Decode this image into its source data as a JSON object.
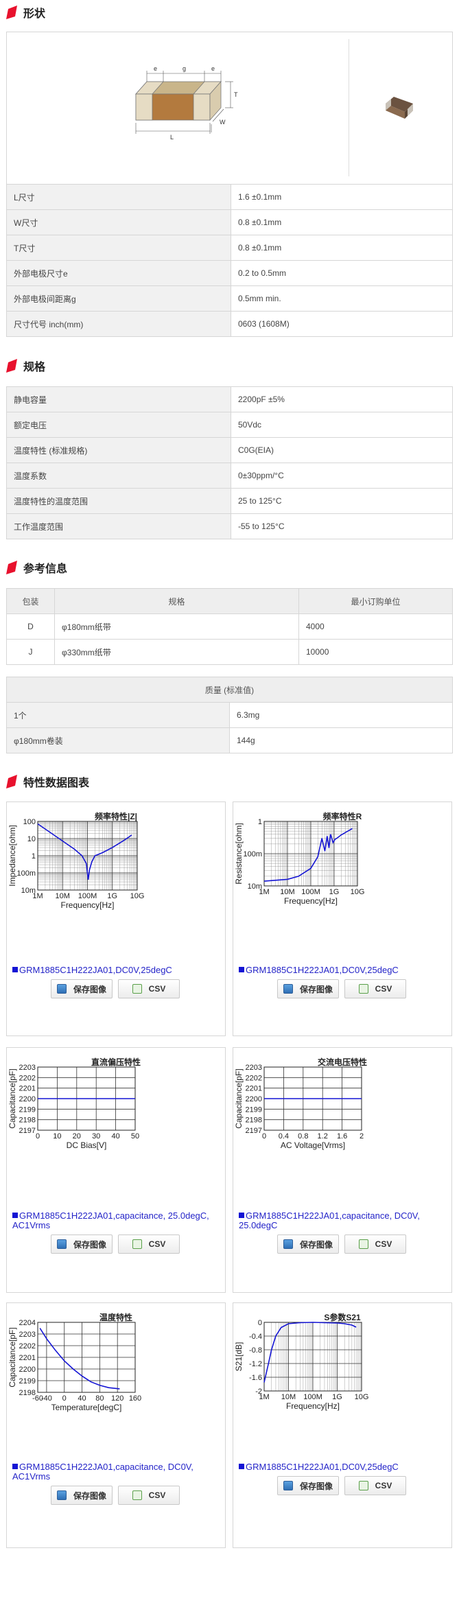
{
  "sections": {
    "shape": "形状",
    "spec": "规格",
    "ref": "参考信息",
    "charts": "特性数据图表"
  },
  "dims": [
    "e",
    "g",
    "e",
    "T",
    "W",
    "L"
  ],
  "shape_rows": [
    {
      "k": "L尺寸",
      "v": "1.6 ±0.1mm"
    },
    {
      "k": "W尺寸",
      "v": "0.8 ±0.1mm"
    },
    {
      "k": "T尺寸",
      "v": "0.8 ±0.1mm"
    },
    {
      "k": "外部电极尺寸e",
      "v": "0.2 to 0.5mm"
    },
    {
      "k": "外部电极间距离g",
      "v": "0.5mm min."
    },
    {
      "k": "尺寸代号 inch(mm)",
      "v": "0603 (1608M)"
    }
  ],
  "spec_rows": [
    {
      "k": "静电容量",
      "v": "2200pF ±5%"
    },
    {
      "k": "额定电压",
      "v": "50Vdc"
    },
    {
      "k": "温度特性 (标准规格)",
      "v": "C0G(EIA)"
    },
    {
      "k": "温度系数",
      "v": "0±30ppm/°C"
    },
    {
      "k": "温度特性的温度范围",
      "v": "25 to 125°C"
    },
    {
      "k": "工作温度范围",
      "v": "-55 to 125°C"
    }
  ],
  "pack": {
    "headers": [
      "包装",
      "规格",
      "最小订购单位"
    ],
    "rows": [
      [
        "D",
        "φ180mm纸带",
        "4000"
      ],
      [
        "J",
        "φ330mm纸带",
        "10000"
      ]
    ]
  },
  "mass": {
    "header": "质量 (标准值)",
    "rows": [
      {
        "k": "1个",
        "v": "6.3mg"
      },
      {
        "k": "φ180mm卷装",
        "v": "144g"
      }
    ]
  },
  "buttons": {
    "save": "保存图像",
    "csv": "CSV"
  },
  "chart_data": [
    {
      "type": "line",
      "title": "频率特性|Z|",
      "xlabel": "Frequency[Hz]",
      "ylabel": "Impedance[ohm]",
      "xscale": "log",
      "yscale": "log",
      "x_ticks": [
        "1M",
        "10M",
        "100M",
        "1G",
        "10G"
      ],
      "y_ticks": [
        "100",
        "10",
        "1",
        "100m",
        "10m"
      ],
      "xlim": [
        1000000,
        10000000000
      ],
      "ylim": [
        0.01,
        100
      ],
      "x": [
        1000000,
        3000000,
        10000000,
        30000000,
        60000000,
        90000000,
        107000000,
        120000000,
        150000000,
        200000000,
        400000000,
        1000000000,
        3000000000,
        6000000000
      ],
      "y": [
        72,
        24,
        7.2,
        2.4,
        1.0,
        0.35,
        0.04,
        0.15,
        0.45,
        1.0,
        1.5,
        3.0,
        8.0,
        16.0
      ],
      "legend": "GRM1885C1H222JA01,DC0V,25degC"
    },
    {
      "type": "line",
      "title": "频率特性R",
      "xlabel": "Frequency[Hz]",
      "ylabel": "Resistance[ohm]",
      "xscale": "log",
      "yscale": "log",
      "x_ticks": [
        "1M",
        "10M",
        "100M",
        "1G",
        "10G"
      ],
      "y_ticks": [
        "1",
        "100m",
        "10m"
      ],
      "xlim": [
        1000000,
        10000000000
      ],
      "ylim": [
        0.01,
        1
      ],
      "x": [
        1000000,
        10000000,
        30000000,
        100000000,
        200000000,
        300000000,
        400000000,
        500000000,
        600000000,
        700000000,
        900000000,
        1100000000,
        1300000000,
        2000000000,
        6000000000
      ],
      "y": [
        0.014,
        0.016,
        0.02,
        0.035,
        0.08,
        0.3,
        0.12,
        0.35,
        0.15,
        0.4,
        0.22,
        0.28,
        0.3,
        0.38,
        0.6
      ],
      "legend": "GRM1885C1H222JA01,DC0V,25degC"
    },
    {
      "type": "line",
      "title": "直流偏压特性",
      "xlabel": "DC Bias[V]",
      "ylabel": "Capacitance[pF]",
      "x_ticks": [
        "0",
        "10",
        "20",
        "30",
        "40",
        "50"
      ],
      "y_ticks": [
        "2203",
        "2202",
        "2201",
        "2200",
        "2199",
        "2198",
        "2197"
      ],
      "xlim": [
        0,
        50
      ],
      "ylim": [
        2197,
        2203
      ],
      "x": [
        0,
        50
      ],
      "y": [
        2200,
        2200
      ],
      "legend": "GRM1885C1H222JA01,capacitance, 25.0degC, AC1Vrms"
    },
    {
      "type": "line",
      "title": "交流电压特性",
      "xlabel": "AC Voltage[Vrms]",
      "ylabel": "Capacitance[pF]",
      "x_ticks": [
        "0",
        "0.4",
        "0.8",
        "1.2",
        "1.6",
        "2"
      ],
      "y_ticks": [
        "2203",
        "2202",
        "2201",
        "2200",
        "2199",
        "2198",
        "2197"
      ],
      "xlim": [
        0,
        2
      ],
      "ylim": [
        2197,
        2203
      ],
      "x": [
        0,
        2
      ],
      "y": [
        2200,
        2200
      ],
      "legend": "GRM1885C1H222JA01,capacitance, DC0V, 25.0degC"
    },
    {
      "type": "line",
      "title": "温度特性",
      "xlabel": "Temperature[degC]",
      "ylabel": "Capacitance[pF]",
      "x_ticks": [
        "-60",
        "-40",
        "0",
        "40",
        "80",
        "120",
        "160"
      ],
      "y_ticks": [
        "2204",
        "2203",
        "2202",
        "2201",
        "2200",
        "2199",
        "2198"
      ],
      "xlim": [
        -60,
        160
      ],
      "ylim": [
        2198,
        2204
      ],
      "x": [
        -55,
        -40,
        -20,
        0,
        20,
        40,
        60,
        80,
        100,
        125
      ],
      "y": [
        2203.5,
        2202.6,
        2201.6,
        2200.7,
        2200.0,
        2199.4,
        2198.9,
        2198.6,
        2198.4,
        2198.3
      ],
      "legend": "GRM1885C1H222JA01,capacitance, DC0V, AC1Vrms"
    },
    {
      "type": "line",
      "title": "S参数S21",
      "xlabel": "Frequency[Hz]",
      "ylabel": "S21[dB]",
      "xscale": "log",
      "x_ticks": [
        "1M",
        "10M",
        "100M",
        "1G",
        "10G"
      ],
      "y_ticks": [
        "0",
        "-0.4",
        "-0.8",
        "-1.2",
        "-1.6",
        "-2"
      ],
      "xlim": [
        1000000,
        10000000000
      ],
      "ylim": [
        -2,
        0
      ],
      "x": [
        1000000,
        1500000,
        2000000,
        3000000,
        5000000,
        10000000,
        30000000,
        100000000,
        300000000,
        1000000000,
        2000000000,
        4000000000,
        6000000000
      ],
      "y": [
        -1.75,
        -1.2,
        -0.8,
        -0.4,
        -0.15,
        -0.04,
        -0.01,
        0,
        -0.01,
        -0.02,
        -0.04,
        -0.08,
        -0.14
      ],
      "legend": "GRM1885C1H222JA01,DC0V,25degC"
    }
  ]
}
